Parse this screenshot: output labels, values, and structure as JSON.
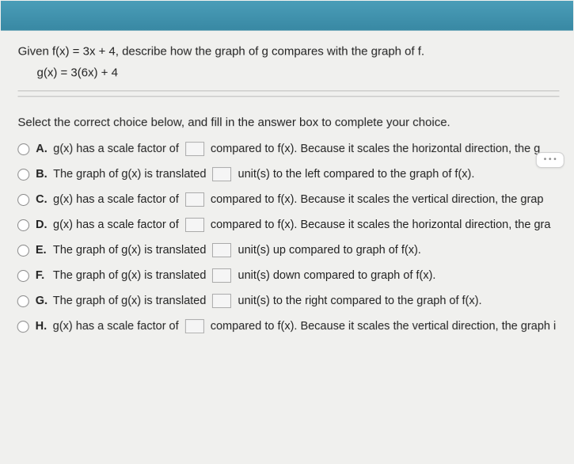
{
  "header": {},
  "question": {
    "stem": "Given f(x) = 3x + 4, describe how the graph of g compares with the graph of f.",
    "equation": "g(x) = 3(6x) + 4"
  },
  "instruction": "Select the correct choice below, and fill in the answer box to complete your choice.",
  "dots": "• • •",
  "choices": [
    {
      "label": "A.",
      "pre": "g(x) has a scale factor of",
      "post": "compared to f(x). Because it scales the horizontal direction, the g"
    },
    {
      "label": "B.",
      "pre": "The graph of g(x) is translated",
      "post": "unit(s) to the left compared to the graph of f(x)."
    },
    {
      "label": "C.",
      "pre": "g(x) has a scale factor of",
      "post": "compared to f(x). Because it scales the vertical direction, the grap"
    },
    {
      "label": "D.",
      "pre": "g(x) has a scale factor of",
      "post": "compared to f(x). Because it scales the horizontal direction, the gra"
    },
    {
      "label": "E.",
      "pre": "The graph of g(x) is translated",
      "post": "unit(s) up compared to graph of f(x)."
    },
    {
      "label": "F.",
      "pre": "The graph of g(x) is translated",
      "post": "unit(s) down compared to graph of f(x)."
    },
    {
      "label": "G.",
      "pre": "The graph of g(x) is translated",
      "post": "unit(s) to the right compared to the graph of f(x)."
    },
    {
      "label": "H.",
      "pre": "g(x) has a scale factor of",
      "post": "compared to f(x). Because it scales the vertical direction, the graph i"
    }
  ]
}
